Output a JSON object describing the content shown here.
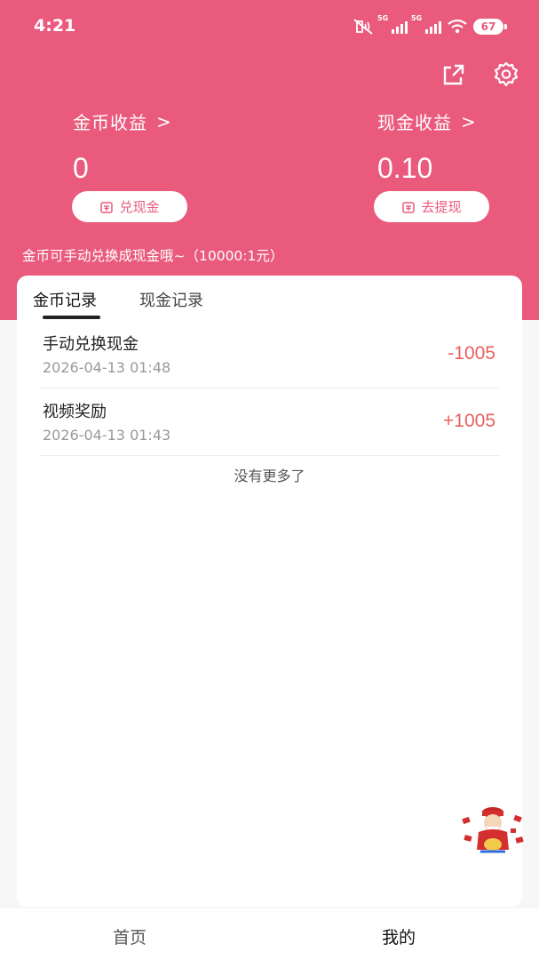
{
  "status_bar": {
    "time": "4:21",
    "battery": "67",
    "network_1": "5G",
    "network_2": "5G"
  },
  "header": {
    "coin_label": "金币收益",
    "coin_value": "0",
    "cash_label": "现金收益",
    "cash_value": "0.10",
    "exchange_button": "兑现金",
    "withdraw_button": "去提现",
    "hint": "金币可手动兑换成现金哦~（10000:1元）"
  },
  "tabs": [
    "金币记录",
    "现金记录"
  ],
  "records": [
    {
      "title": "手动兑换现金",
      "time": "2026-04-13 01:48",
      "amount": "-1005"
    },
    {
      "title": "视频奖励",
      "time": "2026-04-13 01:43",
      "amount": "+1005"
    }
  ],
  "no_more": "没有更多了",
  "bottom_nav": {
    "home": "首页",
    "mine": "我的"
  },
  "colors": {
    "brand": "#e95a7d",
    "amount": "#e96060"
  }
}
